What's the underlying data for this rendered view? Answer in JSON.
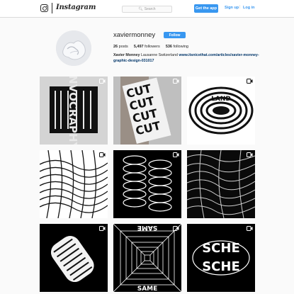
{
  "header": {
    "wordmark": "Instagram",
    "search_placeholder": "Search",
    "get_app_label": "Get the app",
    "signup_label": "Sign up",
    "separator": "|",
    "login_label": "Log in",
    "accent_color": "#3897f0"
  },
  "profile": {
    "username": "xaviermonney",
    "follow_label": "Follow",
    "posts_count": "26",
    "posts_label": "posts",
    "followers_count": "5,497",
    "followers_label": "followers",
    "following_count": "536",
    "following_label": "following",
    "full_name": "Xavier Monney",
    "location": "Lausanne Switzerland",
    "link": "www.itsnicethat.com/articles/xavier-monney-graphic-design-031017"
  },
  "grid": {
    "tiles": [
      {
        "kind": "video",
        "text": "INVOCRAPHY",
        "icon": "video-icon"
      },
      {
        "kind": "video",
        "text": "CUT",
        "icon": "video-icon"
      },
      {
        "kind": "video",
        "text": "LAND",
        "icon": "video-icon"
      },
      {
        "kind": "video",
        "text": "",
        "icon": "video-icon"
      },
      {
        "kind": "video",
        "text": "",
        "icon": "video-icon"
      },
      {
        "kind": "video",
        "text": "",
        "icon": "video-icon"
      },
      {
        "kind": "video",
        "text": "",
        "icon": "video-icon"
      },
      {
        "kind": "video",
        "text": "SAME",
        "icon": "video-icon"
      },
      {
        "kind": "video",
        "text": "SCHE",
        "icon": "video-icon"
      }
    ]
  }
}
